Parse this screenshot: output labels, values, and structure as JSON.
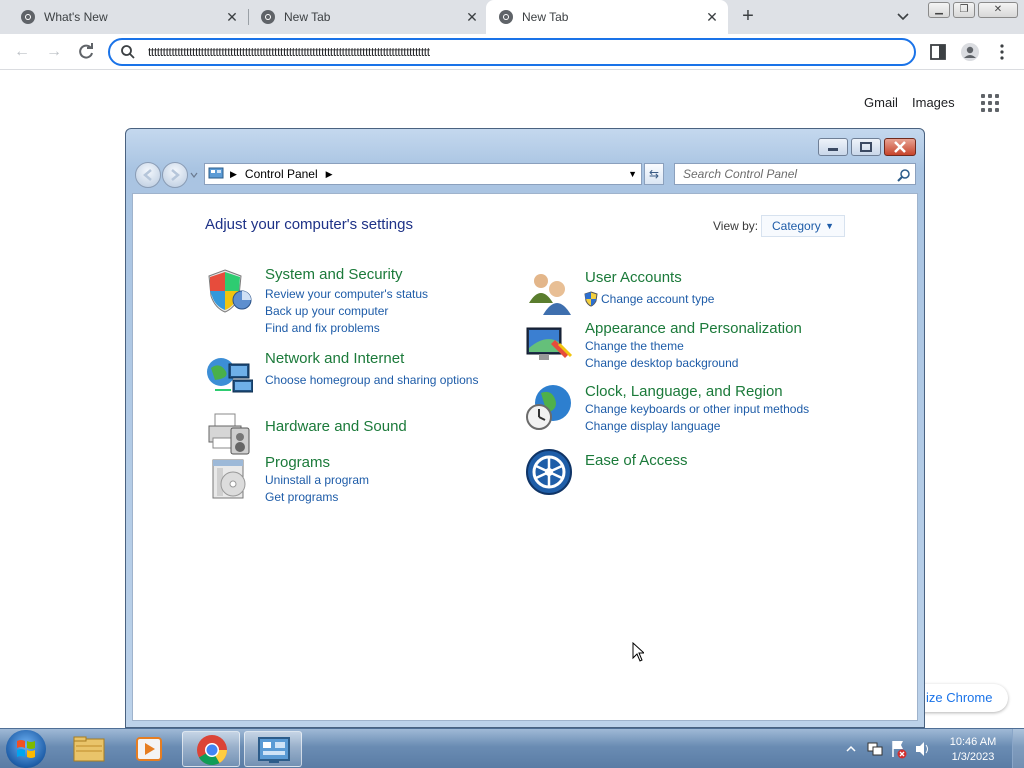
{
  "browser": {
    "tabs": [
      {
        "title": "What's New",
        "active": false
      },
      {
        "title": "New Tab",
        "active": false
      },
      {
        "title": "New Tab",
        "active": true
      }
    ],
    "omnibox_text": "tttttttttttttttttttttttttttttttttttttttttttttttttttttttttttttttttttttttttttttttttttttttttttttttt",
    "accent_color": "#1a73e8"
  },
  "ntp": {
    "gmail": "Gmail",
    "images": "Images",
    "customize": "ize Chrome"
  },
  "control_panel": {
    "breadcrumb": "Control Panel",
    "search_placeholder": "Search Control Panel",
    "heading": "Adjust your computer's settings",
    "view_by_label": "View by:",
    "view_by_value": "Category",
    "categories": [
      {
        "title": "System and Security",
        "icon": "shield-icon",
        "links": [
          "Review your computer's status",
          "Back up your computer",
          "Find and fix problems"
        ]
      },
      {
        "title": "Network and Internet",
        "icon": "network-icon",
        "links": [
          "Choose homegroup and sharing options"
        ]
      },
      {
        "title": "Hardware and Sound",
        "icon": "printer-icon",
        "links": []
      },
      {
        "title": "Programs",
        "icon": "programs-icon",
        "links": [
          "Uninstall a program",
          "Get programs"
        ]
      },
      {
        "title": "User Accounts",
        "icon": "users-icon",
        "links": [
          "Change account type"
        ]
      },
      {
        "title": "Appearance and Personalization",
        "icon": "monitor-icon",
        "links": [
          "Change the theme",
          "Change desktop background"
        ]
      },
      {
        "title": "Clock, Language, and Region",
        "icon": "globe-clock-icon",
        "links": [
          "Change keyboards or other input methods",
          "Change display language"
        ]
      },
      {
        "title": "Ease of Access",
        "icon": "ease-of-access-icon",
        "links": []
      }
    ]
  },
  "taskbar": {
    "time": "10:46 AM",
    "date": "1/3/2023"
  }
}
